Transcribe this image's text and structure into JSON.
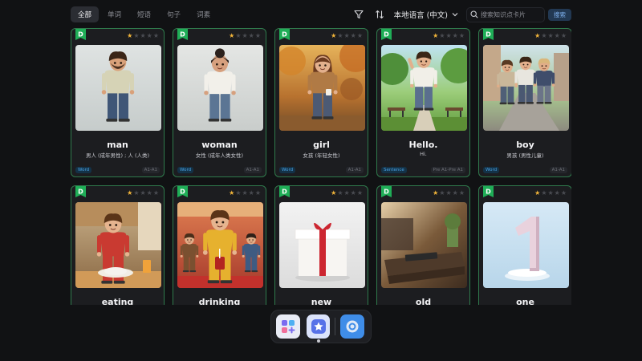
{
  "tabs": [
    {
      "label": "全部",
      "active": true
    },
    {
      "label": "单词",
      "active": false
    },
    {
      "label": "短语",
      "active": false
    },
    {
      "label": "句子",
      "active": false
    },
    {
      "label": "词素",
      "active": false
    }
  ],
  "toolbar": {
    "filter_icon": "filter-icon",
    "sort_icon": "sort-icon",
    "language": "本地语言 (中文)",
    "search_placeholder": "搜索知识点卡片",
    "search_button": "搜索"
  },
  "cards": [
    {
      "word": "man",
      "definition": "男人 (成年男性) ; 人 (人类)",
      "type": "Word",
      "level": "A1-A1",
      "stars": 1,
      "image": "man"
    },
    {
      "word": "woman",
      "definition": "女性 (成年人类女性)",
      "type": "Word",
      "level": "A1-A1",
      "stars": 1,
      "image": "woman"
    },
    {
      "word": "girl",
      "definition": "女孩 (年轻女性)",
      "type": "Word",
      "level": "A1-A1",
      "stars": 1,
      "image": "girl"
    },
    {
      "word": "Hello.",
      "definition": "Hi.",
      "type": "Sentence",
      "level": "Pre A1-Pre A1",
      "stars": 1,
      "image": "hello"
    },
    {
      "word": "boy",
      "definition": "男孩 (男性儿童)",
      "type": "Word",
      "level": "A1-A1",
      "stars": 1,
      "image": "boy"
    },
    {
      "word": "eating",
      "definition": "",
      "type": "",
      "level": "",
      "stars": 1,
      "image": "eating"
    },
    {
      "word": "drinking",
      "definition": "",
      "type": "",
      "level": "",
      "stars": 1,
      "image": "drinking"
    },
    {
      "word": "new",
      "definition": "",
      "type": "",
      "level": "",
      "stars": 1,
      "image": "new"
    },
    {
      "word": "old",
      "definition": "",
      "type": "",
      "level": "",
      "stars": 1,
      "image": "old"
    },
    {
      "word": "one",
      "definition": "",
      "type": "",
      "level": "",
      "stars": 1,
      "image": "one"
    }
  ],
  "dock": [
    {
      "name": "apps-launcher-icon",
      "running": false
    },
    {
      "name": "star-app-icon",
      "running": true
    },
    {
      "name": "settings-app-icon",
      "running": false
    }
  ],
  "colors": {
    "card_border": "#2f7a4c",
    "badge_green": "#1fae57",
    "star_on": "#f2b53a",
    "accent_blue": "#4aa3e6"
  }
}
